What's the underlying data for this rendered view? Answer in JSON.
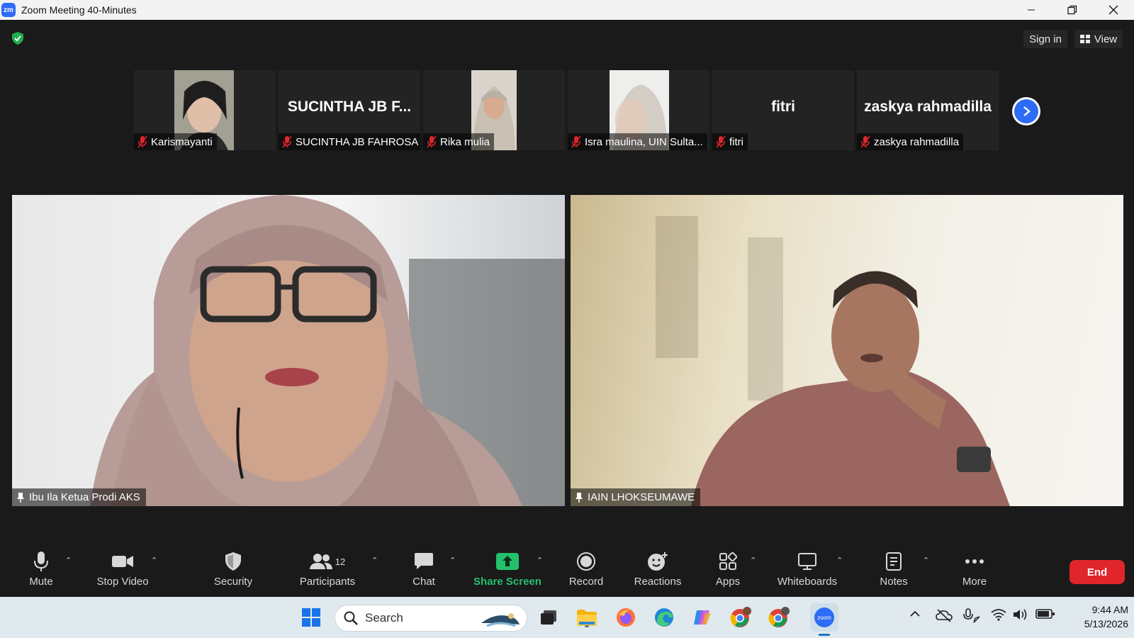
{
  "window": {
    "title": "Zoom Meeting 40-Minutes",
    "logo_text": "zm"
  },
  "header": {
    "sign_in": "Sign in",
    "view": "View"
  },
  "thumbnails": [
    {
      "name": "Karismayanti",
      "has_video": true
    },
    {
      "name": "SUCINTHA JB FAHROSA",
      "display_name": "SUCINTHA JB F...",
      "has_video": false
    },
    {
      "name": "Rika mulia",
      "has_video": true
    },
    {
      "name": "Isra maulina, UIN Sulta...",
      "has_video": true
    },
    {
      "name": "fitri",
      "display_name": "fitri",
      "has_video": false
    },
    {
      "name": "zaskya rahmadilla",
      "display_name": "zaskya rahmadilla",
      "has_video": false
    }
  ],
  "main_videos": [
    {
      "name": "Ibu Ila Ketua Prodi AKS"
    },
    {
      "name": "IAIN LHOKSEUMAWE"
    }
  ],
  "toolbar": {
    "mute": "Mute",
    "stop_video": "Stop Video",
    "security": "Security",
    "participants": "Participants",
    "participants_count": "12",
    "chat": "Chat",
    "share_screen": "Share Screen",
    "record": "Record",
    "reactions": "Reactions",
    "apps": "Apps",
    "whiteboards": "Whiteboards",
    "notes": "Notes",
    "more": "More",
    "end": "End"
  },
  "taskbar": {
    "search_placeholder": "Search",
    "time": "9:44 AM",
    "date": "5/13/2026"
  },
  "colors": {
    "zoom_blue": "#2d6cf5",
    "share_green": "#25c06b",
    "end_red": "#e0262b",
    "muted_red": "#e0262b"
  }
}
